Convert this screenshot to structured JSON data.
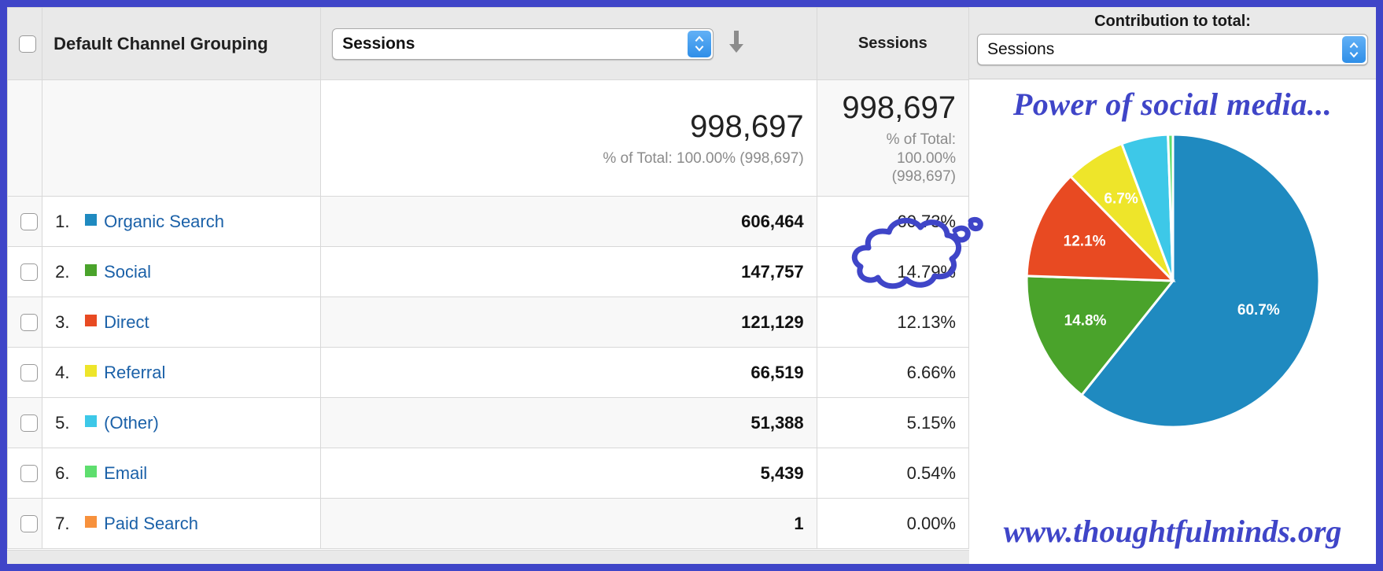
{
  "header": {
    "dimension_label": "Default Channel Grouping",
    "metric_select_value": "Sessions",
    "metric_select_options": [
      "Sessions"
    ],
    "percent_column_label": "Sessions",
    "sort_icon": "sort-descending-arrow-icon",
    "stepper_icon": "stepper-up-down-icon"
  },
  "pie_panel": {
    "contribution_label": "Contribution to total:",
    "contribution_select_value": "Sessions",
    "contribution_select_options": [
      "Sessions"
    ],
    "annotation_title": "Power of social media...",
    "watermark_url": "www.thoughtfulminds.org",
    "highlight_shape": "hand-drawn-thought-cloud"
  },
  "totals": {
    "metric_value": "998,697",
    "metric_subtext": "% of Total: 100.00% (998,697)",
    "percent_value": "998,697",
    "percent_subtext_line1": "% of Total:",
    "percent_subtext_line2": "100.00%",
    "percent_subtext_line3": "(998,697)"
  },
  "rows": [
    {
      "rank": "1.",
      "channel": "Organic Search",
      "color": "#1f8ac0",
      "sessions": "606,464",
      "percent": "60.73%"
    },
    {
      "rank": "2.",
      "channel": "Social",
      "color": "#4aa32b",
      "sessions": "147,757",
      "percent": "14.79%"
    },
    {
      "rank": "3.",
      "channel": "Direct",
      "color": "#e84a22",
      "sessions": "121,129",
      "percent": "12.13%"
    },
    {
      "rank": "4.",
      "channel": "Referral",
      "color": "#eee52a",
      "sessions": "66,519",
      "percent": "6.66%"
    },
    {
      "rank": "5.",
      "channel": "(Other)",
      "color": "#3dc8e8",
      "sessions": "51,388",
      "percent": "5.15%"
    },
    {
      "rank": "6.",
      "channel": "Email",
      "color": "#5ede6e",
      "sessions": "5,439",
      "percent": "0.54%"
    },
    {
      "rank": "7.",
      "channel": "Paid Search",
      "color": "#f7913c",
      "sessions": "1",
      "percent": "0.00%"
    }
  ],
  "chart_data": {
    "type": "pie",
    "title": "Power of social media...",
    "categories": [
      "Organic Search",
      "Social",
      "Direct",
      "Referral",
      "(Other)",
      "Email",
      "Paid Search"
    ],
    "values": [
      606464,
      147757,
      121129,
      66519,
      51388,
      5439,
      1
    ],
    "percentages": [
      60.7,
      14.8,
      12.1,
      6.7,
      5.1,
      0.5,
      0.0
    ],
    "labels_shown": [
      "60.7%",
      "14.8%",
      "12.1%",
      "6.7%",
      "",
      "",
      ""
    ],
    "colors": [
      "#1f8ac0",
      "#4aa32b",
      "#e84a22",
      "#eee52a",
      "#3dc8e8",
      "#5ede6e",
      "#f7913c"
    ],
    "legend": "none",
    "total": 998697,
    "metric": "Sessions"
  },
  "colors": {
    "frame_border": "#3f45c8",
    "annotation": "#3f45c8",
    "link": "#1b61a8",
    "header_bg": "#e9e9e9"
  }
}
